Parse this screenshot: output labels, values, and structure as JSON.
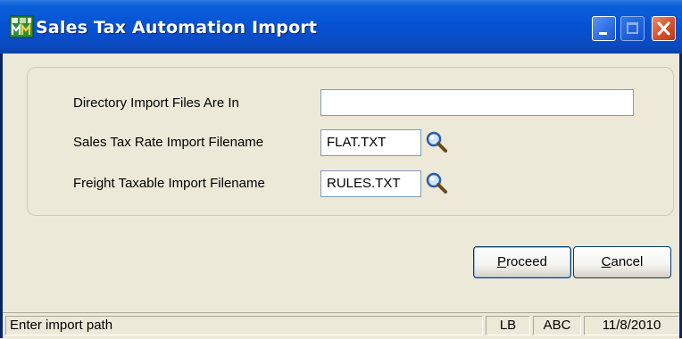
{
  "window": {
    "title": "Sales Tax Automation Import",
    "icon": "sage-mas-app-icon",
    "controls": [
      "minimize-icon",
      "maximize-icon",
      "close-icon"
    ]
  },
  "form": {
    "directory": {
      "label": "Directory Import Files Are In",
      "value": ""
    },
    "rate_file": {
      "label": "Sales Tax Rate Import Filename",
      "value": "FLAT.TXT",
      "lookup_icon": "magnifier-icon"
    },
    "freight_file": {
      "label": "Freight Taxable Import Filename",
      "value": "RULES.TXT",
      "lookup_icon": "magnifier-icon"
    }
  },
  "buttons": {
    "proceed": {
      "mnemonic": "P",
      "rest": "roceed"
    },
    "cancel": {
      "mnemonic": "C",
      "rest": "ancel"
    }
  },
  "statusbar": {
    "message": "Enter import path",
    "user": "LB",
    "company": "ABC",
    "date": "11/8/2010"
  },
  "colors": {
    "titlebar": "#0553d4",
    "window_bg": "#ece9d8",
    "close_button": "#d7502c"
  }
}
